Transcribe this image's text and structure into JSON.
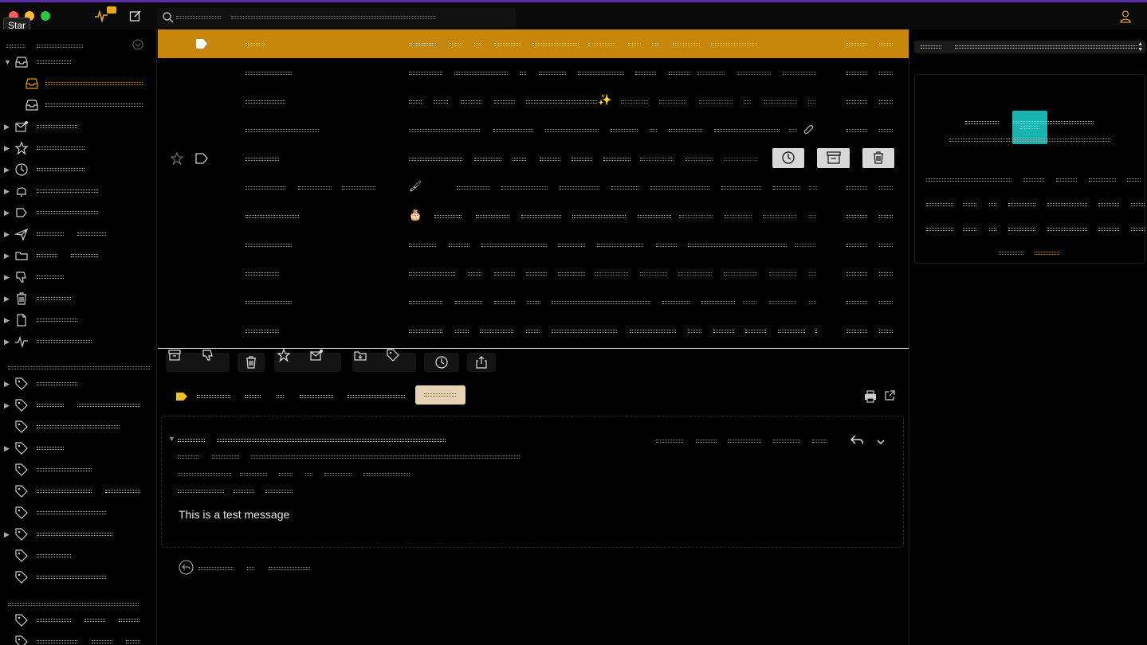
{
  "window": {
    "tooltip": "Star",
    "traffic_colors": [
      "#ff5f57",
      "#febc2e",
      "#28c840"
    ],
    "activity_badge_color": "#e6a817",
    "accent": "#c8870b",
    "avatar_color": "#19b3b0"
  },
  "icons": {
    "compose": "compose-icon",
    "search": "search-icon",
    "activity": "activity-icon",
    "account": "account-icon"
  },
  "message": {
    "body": "This is a test message"
  }
}
